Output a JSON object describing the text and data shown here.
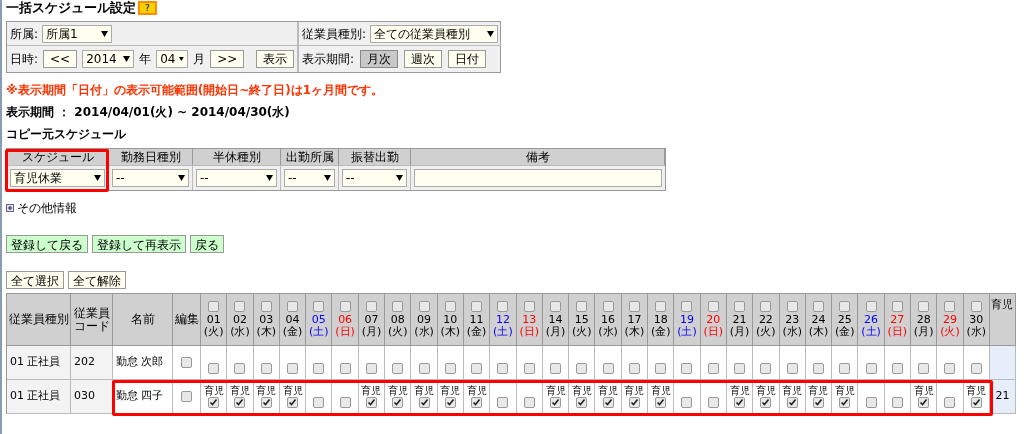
{
  "title": "一括スケジュール設定",
  "help_button": "?",
  "filters": {
    "department_label": "所属:",
    "department": "所属1",
    "employee_type_label": "従業員種別:",
    "employee_type": "全ての従業員種別",
    "date_label": "日時:",
    "prev_button": "<<",
    "year": "2014",
    "year_unit": "年",
    "month": "04",
    "month_unit": "月",
    "next_button": ">>",
    "show_button": "表示",
    "period_label": "表示期間:",
    "period_buttons": [
      {
        "label": "月次",
        "selected": true
      },
      {
        "label": "週次",
        "selected": false
      },
      {
        "label": "日付",
        "selected": false
      }
    ]
  },
  "notice": "※表示期間「日付」の表示可能範囲(開始日~終了日)は1ヶ月間です。",
  "display_period": "表示期間 ： 2014/04/01(火) ~ 2014/04/30(水)",
  "copy_source": {
    "heading": "コピー元スケジュール",
    "columns": [
      "スケジュール",
      "勤務日種別",
      "半休種別",
      "出勤所属",
      "振替出勤",
      "備考"
    ],
    "fields": [
      {
        "value": "育児休業",
        "highlighted": true
      },
      {
        "value": "--",
        "highlighted": false
      },
      {
        "value": "--",
        "highlighted": false
      },
      {
        "value": "--",
        "highlighted": false
      },
      {
        "value": "--",
        "highlighted": false
      }
    ]
  },
  "other_info": "その他情報",
  "action_buttons": [
    "登録して戻る",
    "登録して再表示",
    "戻る"
  ],
  "select_buttons": [
    "全て選択",
    "全て解除"
  ],
  "table": {
    "columns": [
      "従業員種別",
      "従業員コード",
      "名前",
      "編集"
    ],
    "total_column": "育児",
    "days": [
      {
        "date": "01",
        "weekday": "(火)",
        "kind": "weekday",
        "checked": false
      },
      {
        "date": "02",
        "weekday": "(水)",
        "kind": "weekday",
        "checked": false
      },
      {
        "date": "03",
        "weekday": "(木)",
        "kind": "weekday",
        "checked": false
      },
      {
        "date": "04",
        "weekday": "(金)",
        "kind": "weekday",
        "checked": false
      },
      {
        "date": "05",
        "weekday": "(土)",
        "kind": "saturday",
        "checked": false
      },
      {
        "date": "06",
        "weekday": "(日)",
        "kind": "holiday",
        "checked": false
      },
      {
        "date": "07",
        "weekday": "(月)",
        "kind": "weekday",
        "checked": false
      },
      {
        "date": "08",
        "weekday": "(火)",
        "kind": "weekday",
        "checked": false
      },
      {
        "date": "09",
        "weekday": "(水)",
        "kind": "weekday",
        "checked": false
      },
      {
        "date": "10",
        "weekday": "(木)",
        "kind": "weekday",
        "checked": false
      },
      {
        "date": "11",
        "weekday": "(金)",
        "kind": "weekday",
        "checked": false
      },
      {
        "date": "12",
        "weekday": "(土)",
        "kind": "saturday",
        "checked": false
      },
      {
        "date": "13",
        "weekday": "(日)",
        "kind": "holiday",
        "checked": false
      },
      {
        "date": "14",
        "weekday": "(月)",
        "kind": "weekday",
        "checked": false
      },
      {
        "date": "15",
        "weekday": "(火)",
        "kind": "weekday",
        "checked": false
      },
      {
        "date": "16",
        "weekday": "(水)",
        "kind": "weekday",
        "checked": false
      },
      {
        "date": "17",
        "weekday": "(木)",
        "kind": "weekday",
        "checked": false
      },
      {
        "date": "18",
        "weekday": "(金)",
        "kind": "weekday",
        "checked": false
      },
      {
        "date": "19",
        "weekday": "(土)",
        "kind": "saturday",
        "checked": false
      },
      {
        "date": "20",
        "weekday": "(日)",
        "kind": "holiday",
        "checked": false
      },
      {
        "date": "21",
        "weekday": "(月)",
        "kind": "weekday",
        "checked": false
      },
      {
        "date": "22",
        "weekday": "(火)",
        "kind": "weekday",
        "checked": false
      },
      {
        "date": "23",
        "weekday": "(水)",
        "kind": "weekday",
        "checked": false
      },
      {
        "date": "24",
        "weekday": "(木)",
        "kind": "weekday",
        "checked": false
      },
      {
        "date": "25",
        "weekday": "(金)",
        "kind": "weekday",
        "checked": false
      },
      {
        "date": "26",
        "weekday": "(土)",
        "kind": "saturday",
        "checked": false
      },
      {
        "date": "27",
        "weekday": "(日)",
        "kind": "holiday",
        "checked": false
      },
      {
        "date": "28",
        "weekday": "(月)",
        "kind": "weekday",
        "checked": false
      },
      {
        "date": "29",
        "weekday": "(火)",
        "kind": "holiday",
        "checked": false
      },
      {
        "date": "30",
        "weekday": "(水)",
        "kind": "weekday",
        "checked": false
      }
    ],
    "rows": [
      {
        "type": "01 正社員",
        "code": "202",
        "name": "勤怠 次郎",
        "edit": false,
        "highlighted": false,
        "cells": [
          {
            "checked": false
          },
          {
            "checked": false
          },
          {
            "checked": false
          },
          {
            "checked": false
          },
          {
            "checked": false
          },
          {
            "checked": false
          },
          {
            "checked": false
          },
          {
            "checked": false
          },
          {
            "checked": false
          },
          {
            "checked": false
          },
          {
            "checked": false
          },
          {
            "checked": false
          },
          {
            "checked": false
          },
          {
            "checked": false
          },
          {
            "checked": false
          },
          {
            "checked": false
          },
          {
            "checked": false
          },
          {
            "checked": false
          },
          {
            "checked": false
          },
          {
            "checked": false
          },
          {
            "checked": false
          },
          {
            "checked": false
          },
          {
            "checked": false
          },
          {
            "checked": false
          },
          {
            "checked": false
          },
          {
            "checked": false
          },
          {
            "checked": false
          },
          {
            "checked": false
          },
          {
            "checked": false
          },
          {
            "checked": false
          }
        ]
      },
      {
        "type": "01 正社員",
        "code": "030",
        "name": "勤怠 四子",
        "edit": false,
        "highlighted": true,
        "total": "21",
        "cells": [
          {
            "label": "育児",
            "checked": true
          },
          {
            "label": "育児",
            "checked": true
          },
          {
            "label": "育児",
            "checked": true
          },
          {
            "label": "育児",
            "checked": true
          },
          {
            "checked": false
          },
          {
            "checked": false
          },
          {
            "label": "育児",
            "checked": true
          },
          {
            "label": "育児",
            "checked": true
          },
          {
            "label": "育児",
            "checked": true
          },
          {
            "label": "育児",
            "checked": true
          },
          {
            "label": "育児",
            "checked": true
          },
          {
            "checked": false
          },
          {
            "checked": false
          },
          {
            "label": "育児",
            "checked": true
          },
          {
            "label": "育児",
            "checked": true
          },
          {
            "label": "育児",
            "checked": true
          },
          {
            "label": "育児",
            "checked": true
          },
          {
            "label": "育児",
            "checked": true
          },
          {
            "checked": false
          },
          {
            "checked": false
          },
          {
            "label": "育児",
            "checked": true
          },
          {
            "label": "育児",
            "checked": true
          },
          {
            "label": "育児",
            "checked": true
          },
          {
            "label": "育児",
            "checked": true
          },
          {
            "label": "育児",
            "checked": true
          },
          {
            "checked": false
          },
          {
            "checked": false
          },
          {
            "label": "育児",
            "checked": true
          },
          {
            "checked": false
          },
          {
            "label": "育児",
            "checked": true
          }
        ]
      }
    ]
  }
}
